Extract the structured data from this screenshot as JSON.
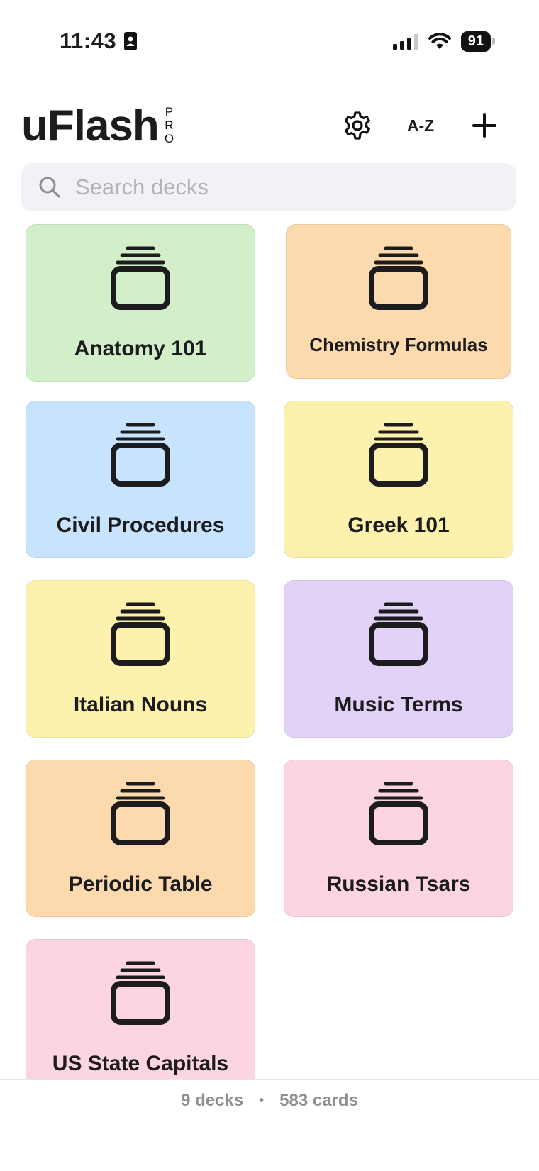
{
  "status_bar": {
    "time": "11:43",
    "battery": "91"
  },
  "header": {
    "title": "uFlash",
    "badge_letters": [
      "P",
      "R",
      "O"
    ],
    "sort_label": "A-Z"
  },
  "search": {
    "placeholder": "Search decks"
  },
  "decks": [
    {
      "label": "Anatomy 101",
      "color": "#d2efc9"
    },
    {
      "label": "Chemistry Formulas",
      "color": "#fcdaad"
    },
    {
      "label": "Civil Procedures",
      "color": "#c8e3fd"
    },
    {
      "label": "Greek 101",
      "color": "#fdf1ae"
    },
    {
      "label": "Italian Nouns",
      "color": "#fdf1ae"
    },
    {
      "label": "Music Terms",
      "color": "#e3d2f7"
    },
    {
      "label": "Periodic Table",
      "color": "#fcdaad"
    },
    {
      "label": "Russian Tsars",
      "color": "#fdd4e1"
    },
    {
      "label": "US State Capitals",
      "color": "#fdd4e1"
    }
  ],
  "deck_icon": "card-stack-icon",
  "footer": {
    "decks_count": "9 decks",
    "separator": "•",
    "cards_count": "583 cards"
  }
}
